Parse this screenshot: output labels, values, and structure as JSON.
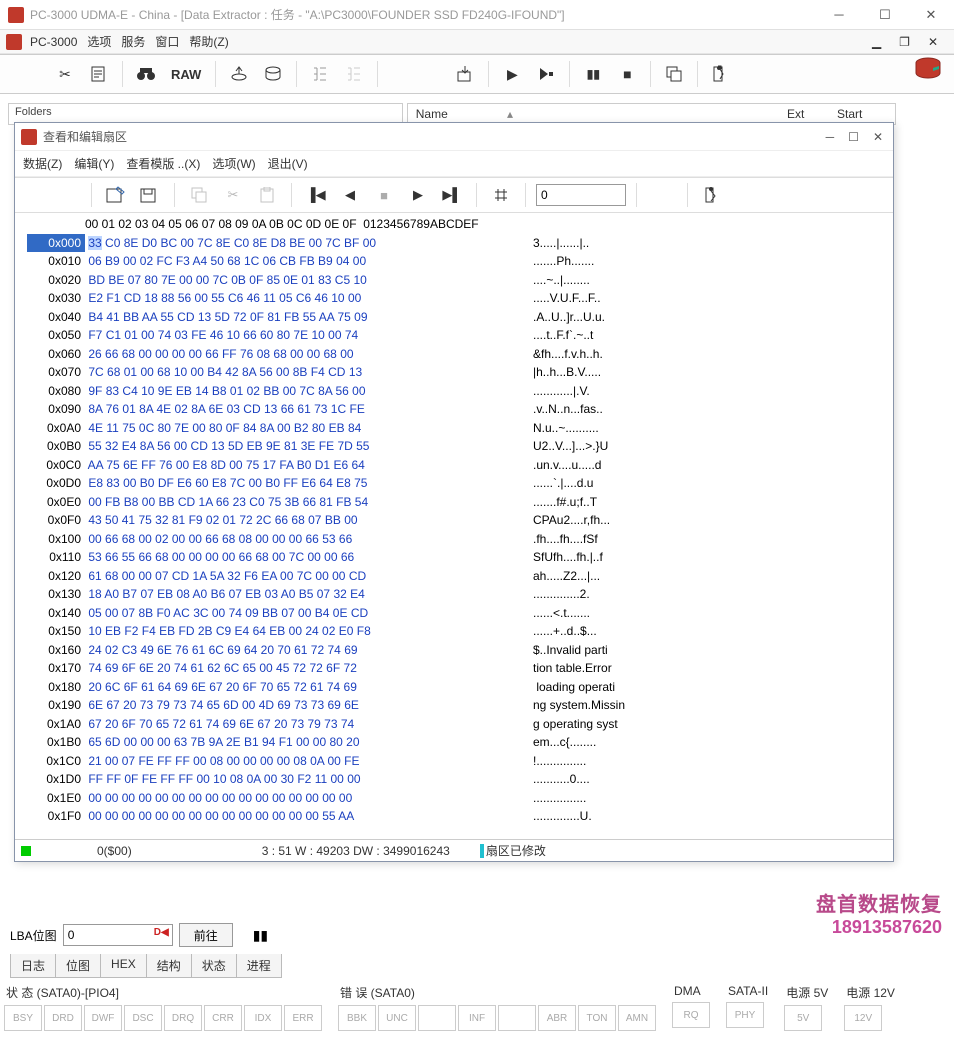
{
  "window": {
    "title": "PC-3000 UDMA-E - China - [Data Extractor : 任务 - \"A:\\PC3000\\FOUNDER SSD FD240G-IFOUND\"]",
    "app_label": "PC-3000"
  },
  "main_menu": [
    "选项",
    "服务",
    "窗口",
    "帮助(Z)"
  ],
  "main_toolbar": {
    "raw_label": "RAW"
  },
  "folders": {
    "title": "Folders"
  },
  "list_header": {
    "name": "Name",
    "ext": "Ext",
    "start": "Start"
  },
  "hex_window": {
    "title": "查看和编辑扇区",
    "menu": [
      "数据(Z)",
      "编辑(Y)",
      "查看模版 ..(X)",
      "选项(W)",
      "退出(V)"
    ],
    "goto_value": "0"
  },
  "hex": {
    "column_header": "   00 01 02 03 04 05 06 07 08 09 0A 0B 0C 0D 0E 0F  0123456789ABCDEF",
    "rows": [
      {
        "addr": "0x000",
        "bytes": "33 C0 8E D0 BC 00 7C 8E C0 8E D8 BE 00 7C BF 00",
        "ascii": "3.....|......|.."
      },
      {
        "addr": "0x010",
        "bytes": "06 B9 00 02 FC F3 A4 50 68 1C 06 CB FB B9 04 00",
        "ascii": ".......Ph......."
      },
      {
        "addr": "0x020",
        "bytes": "BD BE 07 80 7E 00 00 7C 0B 0F 85 0E 01 83 C5 10",
        "ascii": "....~..|........"
      },
      {
        "addr": "0x030",
        "bytes": "E2 F1 CD 18 88 56 00 55 C6 46 11 05 C6 46 10 00",
        "ascii": ".....V.U.F...F.."
      },
      {
        "addr": "0x040",
        "bytes": "B4 41 BB AA 55 CD 13 5D 72 0F 81 FB 55 AA 75 09",
        "ascii": ".A..U..]r...U.u."
      },
      {
        "addr": "0x050",
        "bytes": "F7 C1 01 00 74 03 FE 46 10 66 60 80 7E 10 00 74",
        "ascii": "....t..F.f`.~..t"
      },
      {
        "addr": "0x060",
        "bytes": "26 66 68 00 00 00 00 66 FF 76 08 68 00 00 68 00",
        "ascii": "&fh....f.v.h..h."
      },
      {
        "addr": "0x070",
        "bytes": "7C 68 01 00 68 10 00 B4 42 8A 56 00 8B F4 CD 13",
        "ascii": "|h..h...B.V....."
      },
      {
        "addr": "0x080",
        "bytes": "9F 83 C4 10 9E EB 14 B8 01 02 BB 00 7C 8A 56 00",
        "ascii": "............|.V."
      },
      {
        "addr": "0x090",
        "bytes": "8A 76 01 8A 4E 02 8A 6E 03 CD 13 66 61 73 1C FE",
        "ascii": ".v..N..n...fas.."
      },
      {
        "addr": "0x0A0",
        "bytes": "4E 11 75 0C 80 7E 00 80 0F 84 8A 00 B2 80 EB 84",
        "ascii": "N.u..~.........."
      },
      {
        "addr": "0x0B0",
        "bytes": "55 32 E4 8A 56 00 CD 13 5D EB 9E 81 3E FE 7D 55",
        "ascii": "U2..V...]...>.}U"
      },
      {
        "addr": "0x0C0",
        "bytes": "AA 75 6E FF 76 00 E8 8D 00 75 17 FA B0 D1 E6 64",
        "ascii": ".un.v....u.....d"
      },
      {
        "addr": "0x0D0",
        "bytes": "E8 83 00 B0 DF E6 60 E8 7C 00 B0 FF E6 64 E8 75",
        "ascii": "......`.|....d.u"
      },
      {
        "addr": "0x0E0",
        "bytes": "00 FB B8 00 BB CD 1A 66 23 C0 75 3B 66 81 FB 54",
        "ascii": ".......f#.u;f..T"
      },
      {
        "addr": "0x0F0",
        "bytes": "43 50 41 75 32 81 F9 02 01 72 2C 66 68 07 BB 00",
        "ascii": "CPAu2....r,fh..."
      },
      {
        "addr": "0x100",
        "bytes": "00 66 68 00 02 00 00 66 68 08 00 00 00 66 53 66",
        "ascii": ".fh....fh....fSf"
      },
      {
        "addr": "0x110",
        "bytes": "53 66 55 66 68 00 00 00 00 66 68 00 7C 00 00 66",
        "ascii": "SfUfh....fh.|..f"
      },
      {
        "addr": "0x120",
        "bytes": "61 68 00 00 07 CD 1A 5A 32 F6 EA 00 7C 00 00 CD",
        "ascii": "ah.....Z2...|..."
      },
      {
        "addr": "0x130",
        "bytes": "18 A0 B7 07 EB 08 A0 B6 07 EB 03 A0 B5 07 32 E4",
        "ascii": "..............2."
      },
      {
        "addr": "0x140",
        "bytes": "05 00 07 8B F0 AC 3C 00 74 09 BB 07 00 B4 0E CD",
        "ascii": "......<.t......."
      },
      {
        "addr": "0x150",
        "bytes": "10 EB F2 F4 EB FD 2B C9 E4 64 EB 00 24 02 E0 F8",
        "ascii": "......+..d..$..."
      },
      {
        "addr": "0x160",
        "bytes": "24 02 C3 49 6E 76 61 6C 69 64 20 70 61 72 74 69",
        "ascii": "$..Invalid parti"
      },
      {
        "addr": "0x170",
        "bytes": "74 69 6F 6E 20 74 61 62 6C 65 00 45 72 72 6F 72",
        "ascii": "tion table.Error"
      },
      {
        "addr": "0x180",
        "bytes": "20 6C 6F 61 64 69 6E 67 20 6F 70 65 72 61 74 69",
        "ascii": " loading operati"
      },
      {
        "addr": "0x190",
        "bytes": "6E 67 20 73 79 73 74 65 6D 00 4D 69 73 73 69 6E",
        "ascii": "ng system.Missin"
      },
      {
        "addr": "0x1A0",
        "bytes": "67 20 6F 70 65 72 61 74 69 6E 67 20 73 79 73 74",
        "ascii": "g operating syst"
      },
      {
        "addr": "0x1B0",
        "bytes": "65 6D 00 00 00 63 7B 9A 2E B1 94 F1 00 00 80 20",
        "ascii": "em...c{........ "
      },
      {
        "addr": "0x1C0",
        "bytes": "21 00 07 FE FF FF 00 08 00 00 00 00 08 0A 00 FE",
        "ascii": "!..............."
      },
      {
        "addr": "0x1D0",
        "bytes": "FF FF 0F FE FF FF 00 10 08 0A 00 30 F2 11 00 00",
        "ascii": "...........0...."
      },
      {
        "addr": "0x1E0",
        "bytes": "00 00 00 00 00 00 00 00 00 00 00 00 00 00 00 00",
        "ascii": "................"
      },
      {
        "addr": "0x1F0",
        "bytes": "00 00 00 00 00 00 00 00 00 00 00 00 00 00 55 AA",
        "ascii": "..............U."
      }
    ],
    "status": {
      "offset": "0($00)",
      "counts": "3 : 51 W : 49203 DW : 3499016243",
      "modified": "扇区已修改"
    }
  },
  "watermark": {
    "line1": "盘首数据恢复",
    "line2": "18913587620"
  },
  "lba": {
    "label": "LBA位图",
    "value": "0",
    "go": "前往"
  },
  "tabs": [
    "日志",
    "位图",
    "HEX",
    "结构",
    "状态",
    "进程"
  ],
  "status_groups": {
    "sata0": {
      "label": "状 态 (SATA0)-[PIO4]",
      "boxes": [
        "BSY",
        "DRD",
        "DWF",
        "DSC",
        "DRQ",
        "CRR",
        "IDX",
        "ERR"
      ]
    },
    "err": {
      "label": "错 误 (SATA0)",
      "boxes": [
        "BBK",
        "UNC",
        "",
        "INF",
        "",
        "ABR",
        "TON",
        "AMN"
      ]
    },
    "dma": {
      "label": "DMA",
      "boxes": [
        "RQ"
      ]
    },
    "sata2": {
      "label": "SATA-II",
      "boxes": [
        "PHY"
      ]
    },
    "p5": {
      "label": "电源 5V",
      "boxes": [
        "5V"
      ]
    },
    "p12": {
      "label": "电源 12V",
      "boxes": [
        "12V"
      ]
    }
  }
}
